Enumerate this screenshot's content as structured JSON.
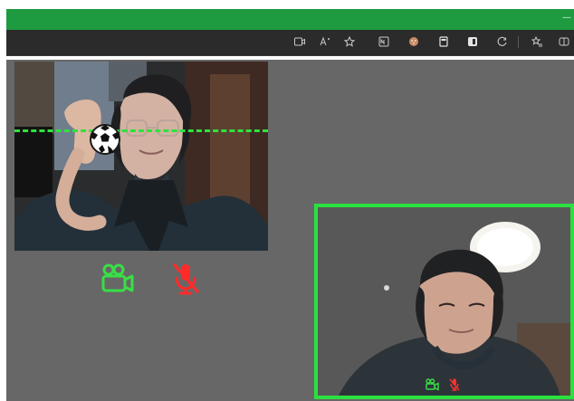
{
  "window": {
    "title": "",
    "minimize_icon": "minimize-icon",
    "accent_color": "#1e9a41"
  },
  "toolbar": {
    "icons": [
      "camera-icon",
      "read-aloud-icon",
      "favorite-add-icon",
      "reader-view-icon",
      "extension-cookie-icon",
      "bookmark-icon",
      "sidebar-icon",
      "refresh-icon",
      "collections-icon",
      "favorites-icon",
      "split-screen-icon"
    ]
  },
  "local_call": {
    "ball_icon": "soccer-ball-icon",
    "tracking_line_color": "#2ee33c",
    "camera_status": "on",
    "microphone_status": "muted"
  },
  "remote_call": {
    "border_color": "#2be03f",
    "camera_status": "on",
    "microphone_status": "muted"
  }
}
